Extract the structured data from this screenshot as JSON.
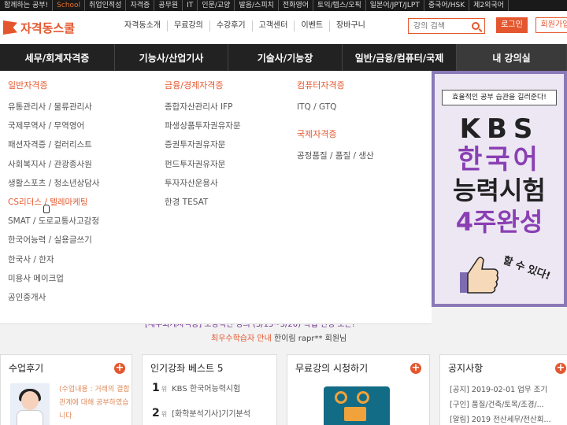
{
  "topbar": [
    "함께하는 공부!",
    "School",
    "취업인적성",
    "자격증",
    "공무원",
    "IT",
    "인문/교양",
    "발음/스피치",
    "전화영어",
    "토익/텝스/오픽",
    "일본어/JPT/JLPT",
    "중국어/HSK",
    "제2외국어"
  ],
  "header": {
    "logo": "자격동스쿨",
    "gnb": [
      "자격동소개",
      "무료강의",
      "수강후기",
      "고객센터",
      "이벤트",
      "장바구니"
    ],
    "search_placeholder": "강의 검색",
    "login": "로그인",
    "join": "회원가입"
  },
  "mainnav": [
    {
      "label": "세무/회계자격증"
    },
    {
      "label": "기능사/산업기사"
    },
    {
      "label": "기술사/기능장"
    },
    {
      "label": "일반/금융/컴퓨터/국제"
    },
    {
      "label": "내 강의실"
    }
  ],
  "dropdown": {
    "col1": {
      "title": "일반자격증",
      "items": [
        "유통관리사 / 물류관리사",
        "국제무역사 / 무역영어",
        "패션자격증 / 컬러리스트",
        "사회복지사 / 관광종사원",
        "생활스포츠 / 청소년상담사",
        "CS리더스 / 텔레마케팅",
        "SMAT / 도로교통사고감정",
        "한국어능력 / 실용글쓰기",
        "한국사 / 한자",
        "미용사 메이크업",
        "공인중개사"
      ]
    },
    "col2": {
      "title": "금융/경제자격증",
      "items": [
        "종합자산관리사 IFP",
        "파생상품투자권유자문",
        "증권투자권유자문",
        "펀드투자권유자문",
        "투자자산운용사",
        "한경 TESAT"
      ]
    },
    "col3": {
      "title": "컴퓨터자격증",
      "items": [
        "ITQ / GTQ"
      ],
      "title2": "국제자격증",
      "items2": [
        "공정품질 / 품질 / 생산"
      ]
    }
  },
  "banner": {
    "tagline": "효율적인 공부 습관을 길러준다!",
    "line1": "KBS",
    "line2": "한국어",
    "line3": "능력시험",
    "line4": "4주완성",
    "cheer": "할 수 있다!"
  },
  "notice": {
    "line1": "[세무회계자격증] 보강적인 강의 (3/13~3/20) 학업 신청 오픈!",
    "line2_hl": "최우수학습자 안내",
    "line2": "한이림 rapr** 회원님"
  },
  "boxes": {
    "review": {
      "title": "수업후기",
      "text": "(수업내용 : 거래의 결합관계에 대해 공부하였습니다"
    },
    "best": {
      "title": "인기강좌 베스트 5",
      "items": [
        {
          "rank": "1",
          "unit": "위",
          "label": "KBS 한국어능력시험"
        },
        {
          "rank": "2",
          "unit": "위",
          "label": "[화학분석기사]기기분석"
        }
      ]
    },
    "free": {
      "title": "무료강의 시청하기"
    },
    "notice": {
      "title": "공지사항",
      "items": [
        "[공지] 2019-02-01 업무 조기",
        "[구인] 품질/건축/토목/조경/...",
        "[알림] 2019 전산세무/전산회..."
      ]
    }
  },
  "colors": {
    "accent": "#e4572e",
    "nav_bg": "#222222",
    "banner_purple": "#8a3fb3"
  }
}
